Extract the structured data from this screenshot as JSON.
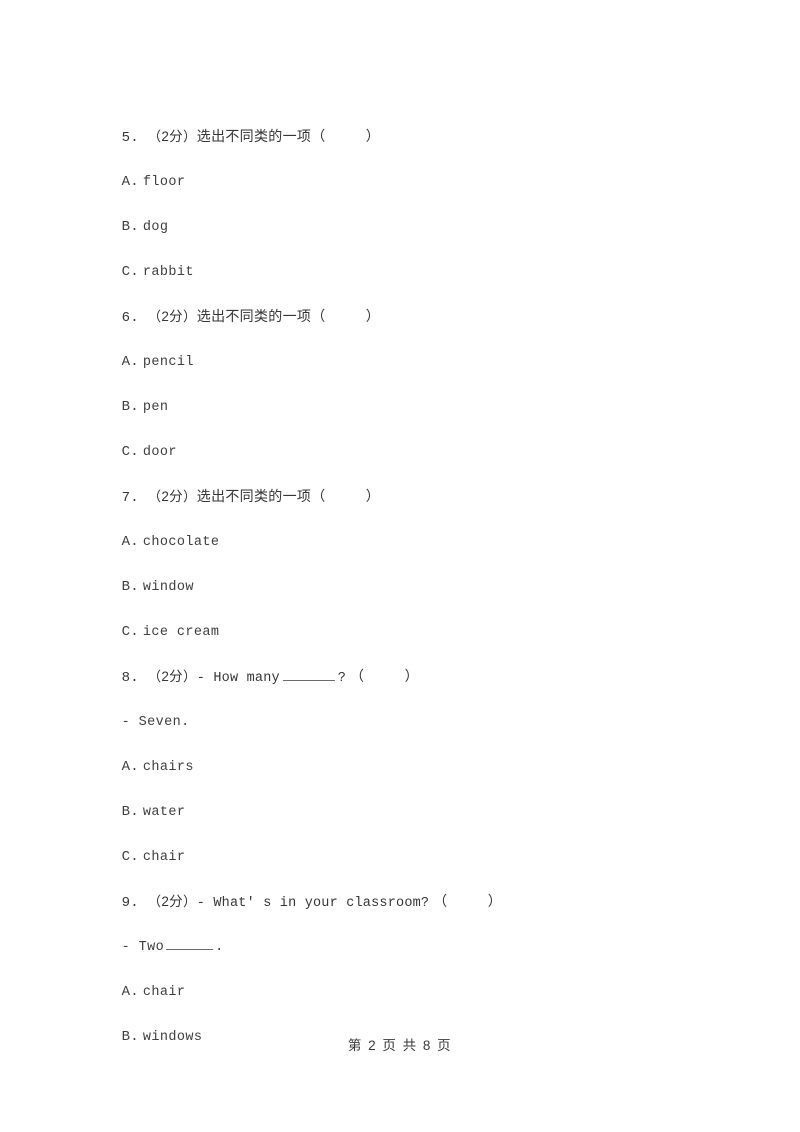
{
  "document": {
    "type": "scanned-exam-page",
    "background_color": "#ffffff",
    "text_color": "#3a3a3a"
  },
  "footer": {
    "page_label": "第 2 页 共 8 页"
  },
  "questions": [
    {
      "number": "5.",
      "score": "（2分）",
      "stem": "选出不同类的一项",
      "answer_paren": "（    ）",
      "options": [
        {
          "letter": "A",
          "sep": ".",
          "text": "floor"
        },
        {
          "letter": "B",
          "sep": ".",
          "text": "dog"
        },
        {
          "letter": "C",
          "sep": ".",
          "text": "rabbit"
        }
      ]
    },
    {
      "number": "6.",
      "score": "（2分）",
      "stem": "选出不同类的一项",
      "answer_paren": "（    ）",
      "options": [
        {
          "letter": "A",
          "sep": ".",
          "text": "pencil"
        },
        {
          "letter": "B",
          "sep": ".",
          "text": "pen"
        },
        {
          "letter": "C",
          "sep": ".",
          "text": "door"
        }
      ]
    },
    {
      "number": "7.",
      "score": "（2分）",
      "stem": "选出不同类的一项",
      "answer_paren": "（    ）",
      "options": [
        {
          "letter": "A",
          "sep": ".",
          "text": "chocolate"
        },
        {
          "letter": "B",
          "sep": ".",
          "text": "window"
        },
        {
          "letter": "C",
          "sep": ".",
          "text": "ice cream"
        }
      ]
    },
    {
      "number": "8.",
      "score": "（2分）",
      "stem_before_blank": "- How many",
      "stem_after_blank": "?",
      "answer_paren": "（    ）",
      "dialogue_reply": "- Seven.",
      "options": [
        {
          "letter": "A",
          "sep": ".",
          "text": "chairs"
        },
        {
          "letter": "B",
          "sep": ".",
          "text": "water"
        },
        {
          "letter": "C",
          "sep": ".",
          "text": "chair"
        }
      ]
    },
    {
      "number": "9.",
      "score": "（2分）",
      "stem": "- What' s in your classroom?",
      "answer_paren": "（    ）",
      "dialogue_reply_before_blank": "- Two",
      "dialogue_reply_after_blank": ".",
      "options": [
        {
          "letter": "A",
          "sep": ".",
          "text": "chair"
        },
        {
          "letter": "B",
          "sep": ".",
          "text": "windows"
        }
      ]
    }
  ]
}
